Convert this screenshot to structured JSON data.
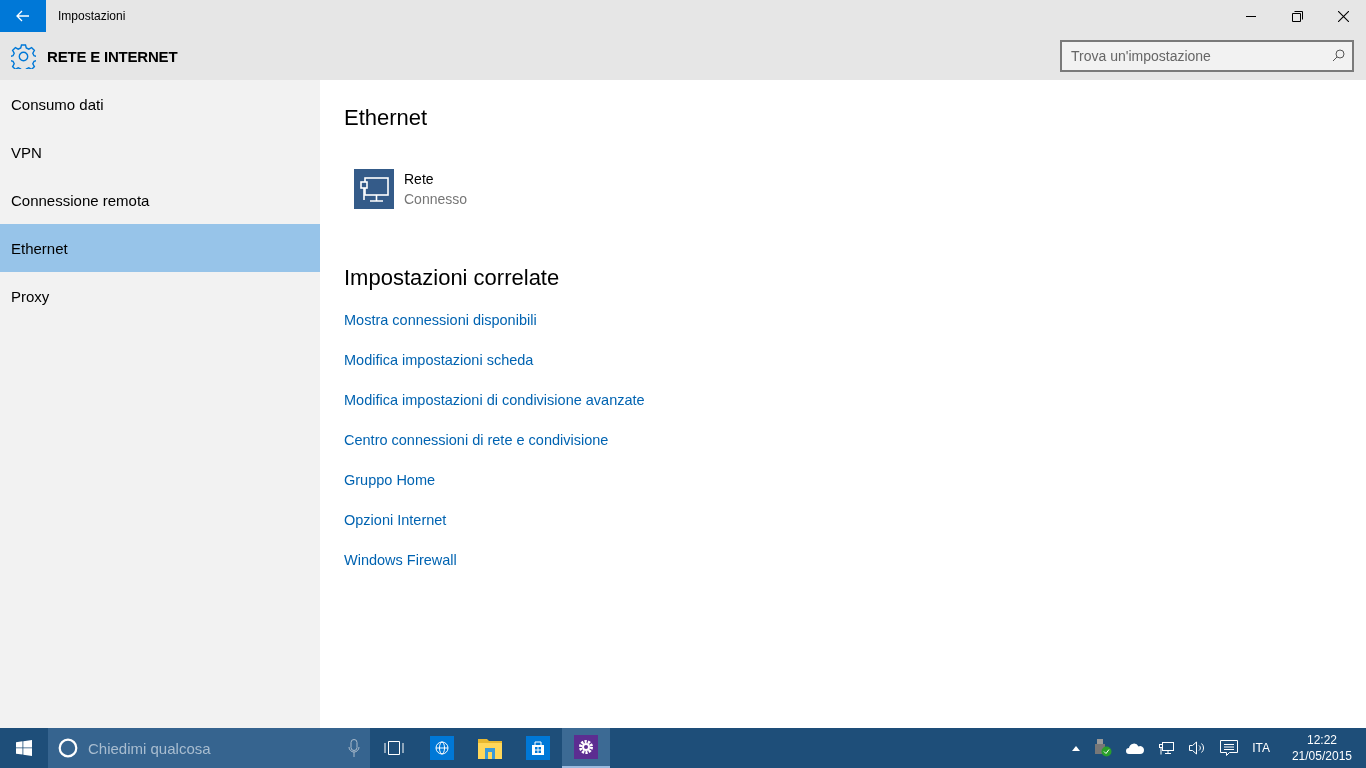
{
  "window": {
    "title": "Impostazioni"
  },
  "header": {
    "title": "RETE E INTERNET",
    "search": {
      "placeholder": "Trova un'impostazione"
    }
  },
  "sidebar": {
    "items": [
      {
        "label": "Consumo dati",
        "selected": false
      },
      {
        "label": "VPN",
        "selected": false
      },
      {
        "label": "Connessione remota",
        "selected": false
      },
      {
        "label": "Ethernet",
        "selected": true
      },
      {
        "label": "Proxy",
        "selected": false
      }
    ]
  },
  "content": {
    "heading": "Ethernet",
    "network": {
      "name": "Rete",
      "status": "Connesso"
    },
    "related_heading": "Impostazioni correlate",
    "links": [
      "Mostra connessioni disponibili",
      "Modifica impostazioni scheda",
      "Modifica impostazioni di condivisione avanzate",
      "Centro connessioni di rete e condivisione",
      "Gruppo Home",
      "Opzioni Internet",
      "Windows Firewall"
    ]
  },
  "taskbar": {
    "search": {
      "placeholder": "Chiedimi qualcosa"
    },
    "apps": [
      {
        "kind": "browser",
        "selected": false
      },
      {
        "kind": "explorer",
        "selected": false
      },
      {
        "kind": "store",
        "selected": false
      },
      {
        "kind": "settings",
        "selected": true
      }
    ],
    "language": "ITA",
    "time": "12:22",
    "date": "21/05/2015"
  }
}
